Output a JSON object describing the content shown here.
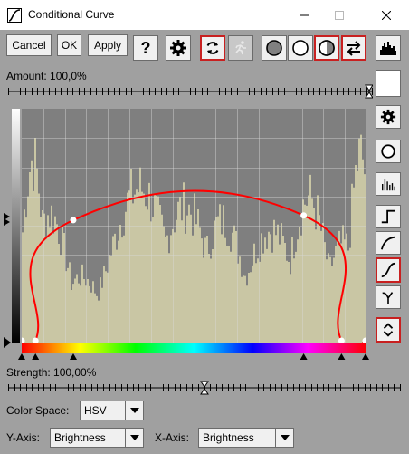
{
  "window": {
    "title": "Conditional Curve"
  },
  "toolbar": {
    "cancel_label": "Cancel",
    "ok_label": "OK",
    "apply_label": "Apply",
    "help_label": "?"
  },
  "amount": {
    "label": "Amount: 100,0%",
    "value_fraction": 1.0
  },
  "strength": {
    "label": "Strength: 100,00%",
    "value_fraction": 0.5
  },
  "color_space": {
    "label": "Color Space:",
    "value": "HSV"
  },
  "y_axis": {
    "label": "Y-Axis:",
    "value": "Brightness"
  },
  "x_axis": {
    "label": "X-Axis:",
    "value": "Brightness"
  },
  "curve": {
    "points": [
      [
        0.0,
        0.0
      ],
      [
        0.04,
        0.0
      ],
      [
        0.15,
        0.52
      ],
      [
        0.82,
        0.54
      ],
      [
        0.93,
        0.0
      ],
      [
        1.0,
        0.0
      ]
    ]
  },
  "colors": {
    "accent": "#c82020",
    "curve": "#ff0000",
    "histogram": "#c9c6a4",
    "plot_bg": "#7f7f7f",
    "window_bg": "#a0a0a0"
  }
}
